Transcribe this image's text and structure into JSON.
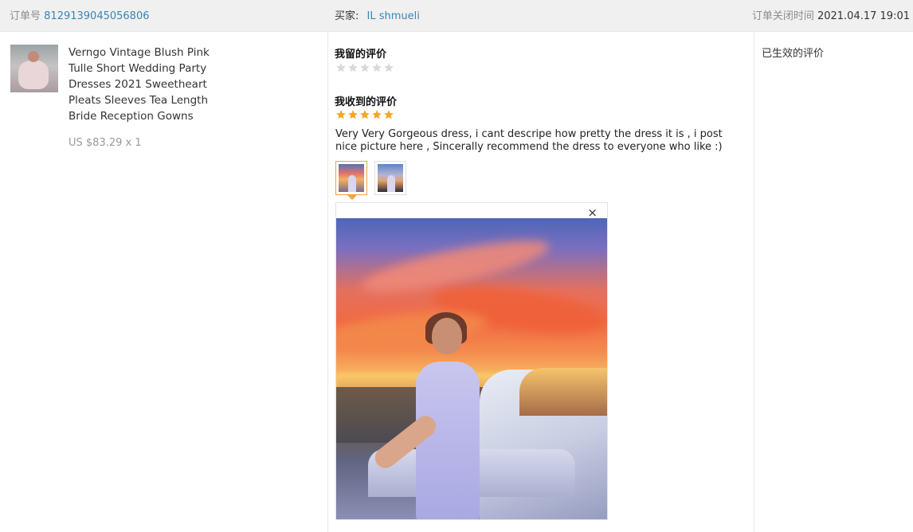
{
  "header": {
    "order_label": "订单号",
    "order_number": "8129139045056806",
    "buyer_label": "买家:",
    "buyer_name": "IL shmueli",
    "closed_label": "订单关闭时间",
    "closed_time": "2021.04.17 19:01"
  },
  "product": {
    "title": "Verngo Vintage Blush Pink Tulle Short Wedding Party Dresses 2021 Sweetheart Pleats Sleeves Tea Length Bride Reception Gowns",
    "price": "US $83.29 x 1"
  },
  "my_review": {
    "title": "我留的评价",
    "rating": 0,
    "max_rating": 5
  },
  "received_review": {
    "title": "我收到的评价",
    "rating": 5,
    "max_rating": 5,
    "text": "Very Very Gorgeous dress, i cant descripe how pretty the dress it is , i post nice picture here , Sincerally recommend the dress to everyone who like :)",
    "photos": [
      "photo-sunset-car",
      "photo-sunset-car-2"
    ],
    "close_icon": "×"
  },
  "status": {
    "label": "已生效的评价"
  },
  "colors": {
    "link": "#3a84b6",
    "star_active": "#f5a623",
    "star_inactive": "#d9d9d9",
    "header_bg": "#f0f0f0",
    "active_border": "#f0a43b"
  }
}
